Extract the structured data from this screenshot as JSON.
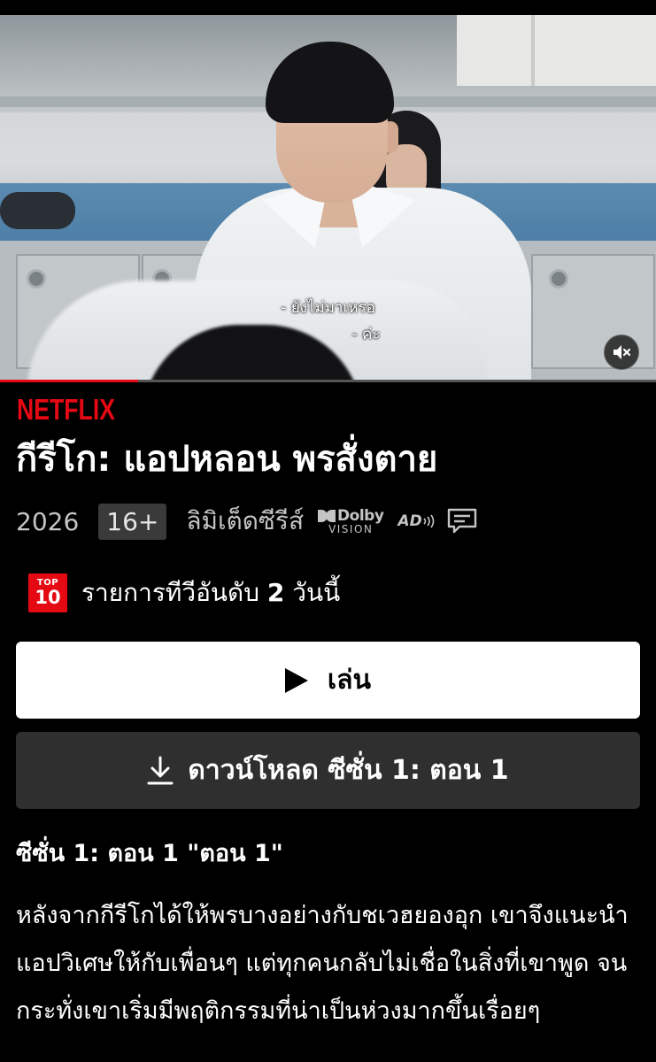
{
  "video": {
    "subtitle_line1": "- ยังไม่มาเหรอ",
    "subtitle_line2": "- ค่ะ",
    "mute_icon": "speaker-muted-icon",
    "progress_fraction": 0.21
  },
  "brand": {
    "name": "NETFLIX",
    "color": "#e50914"
  },
  "show": {
    "title": "กีรีโก: แอปหลอน พรสั่งตาย",
    "year": "2026",
    "rating": "16+",
    "category": "ลิมิเต็ดซีรีส์",
    "dolby_top": "Dolby",
    "dolby_bottom": "VISION",
    "ad_label": "AD",
    "subtitles_icon": "subtitles-icon"
  },
  "top10": {
    "badge_top": "TOP",
    "badge_number": "10",
    "text_prefix": "รายการทีวีอันดับ",
    "rank": "2",
    "text_suffix": "วันนี้"
  },
  "actions": {
    "play_label": "เล่น",
    "download_label": "ดาวน์โหลด ซีซั่น 1: ตอน 1"
  },
  "episode": {
    "title": "ซีซั่น 1: ตอน 1 \"ตอน 1\"",
    "synopsis": "หลังจากกีรีโกได้ให้พรบางอย่างกับชเวฮยองอุก เขาจึงแนะนำแอปวิเศษให้กับเพื่อนๆ แต่ทุกคนกลับไม่เชื่อในสิ่งที่เขาพูด จนกระทั่งเขาเริ่มมีพฤติกรรมที่น่าเป็นห่วงมากขึ้นเรื่อยๆ"
  }
}
